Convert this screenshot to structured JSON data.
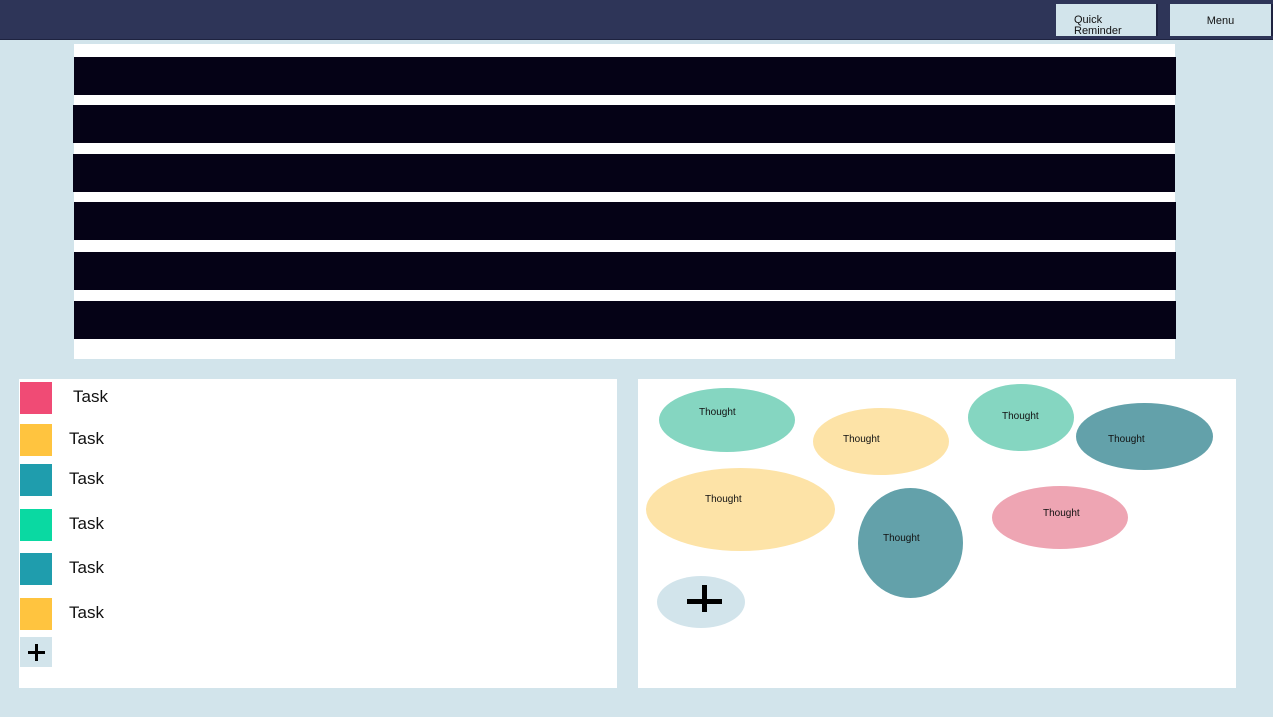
{
  "topbar": {
    "quick_reminder_label": "Quick Reminder",
    "menu_label": "Menu"
  },
  "schedule": {
    "bar_count": 6,
    "bar_color": "#050216"
  },
  "tasks": {
    "items": [
      {
        "label": "Task",
        "color": "#f04b75"
      },
      {
        "label": "Task",
        "color": "#ffc43f"
      },
      {
        "label": "Task",
        "color": "#1f9dad"
      },
      {
        "label": "Task",
        "color": "#0ad9a2"
      },
      {
        "label": "Task",
        "color": "#1f9dad"
      },
      {
        "label": "Task",
        "color": "#ffc43f"
      }
    ],
    "add_icon": "plus-icon"
  },
  "thoughts": {
    "items": [
      {
        "label": "Thought",
        "color": "#85d6c1"
      },
      {
        "label": "Thought",
        "color": "#fde3a7"
      },
      {
        "label": "Thought",
        "color": "#85d6c1"
      },
      {
        "label": "Thought",
        "color": "#63a1aa"
      },
      {
        "label": "Thought",
        "color": "#fde3a7"
      },
      {
        "label": "Thought",
        "color": "#63a1aa"
      },
      {
        "label": "Thought",
        "color": "#eea5b3"
      }
    ],
    "add_icon": "plus-icon"
  }
}
